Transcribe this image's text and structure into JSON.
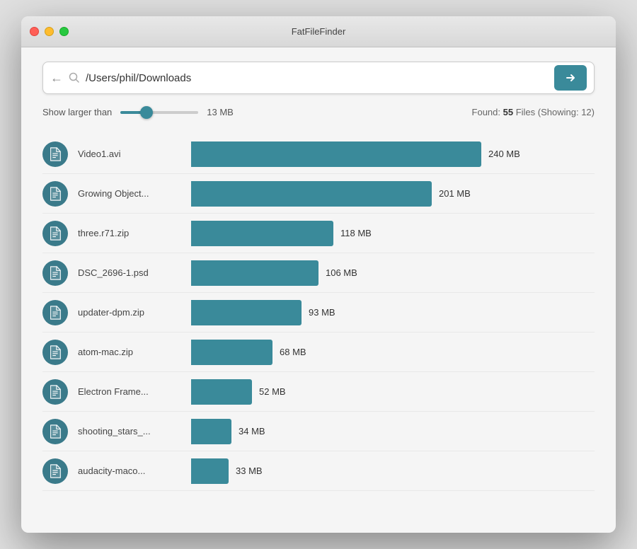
{
  "window": {
    "title": "FatFileFinder"
  },
  "titlebar": {
    "title": "FatFileFinder"
  },
  "searchbar": {
    "back_label": "←",
    "path_value": "/Users/phil/Downloads",
    "path_placeholder": "/Users/phil/Downloads",
    "go_label": "→"
  },
  "filter": {
    "label": "Show larger than",
    "size_value": "13 MB",
    "slider_value": 30,
    "found_prefix": "Found: ",
    "found_count": "55",
    "found_unit": " Files",
    "showing_label": "(Showing: 12)"
  },
  "files": [
    {
      "name": "Video1.avi",
      "size": "240 MB",
      "bar_pct": 100
    },
    {
      "name": "Growing Object...",
      "size": "201 MB",
      "bar_pct": 83
    },
    {
      "name": "three.r71.zip",
      "size": "118 MB",
      "bar_pct": 49
    },
    {
      "name": "DSC_2696-1.psd",
      "size": "106 MB",
      "bar_pct": 44
    },
    {
      "name": "updater-dpm.zip",
      "size": "93 MB",
      "bar_pct": 38
    },
    {
      "name": "atom-mac.zip",
      "size": "68 MB",
      "bar_pct": 28
    },
    {
      "name": "Electron Frame...",
      "size": "52 MB",
      "bar_pct": 21
    },
    {
      "name": "shooting_stars_...",
      "size": "34 MB",
      "bar_pct": 14
    },
    {
      "name": "audacity-maco...",
      "size": "33 MB",
      "bar_pct": 13
    }
  ],
  "colors": {
    "accent": "#3a8a9a",
    "bar": "#3a8a9a",
    "icon_bg": "#3a7a8a"
  }
}
